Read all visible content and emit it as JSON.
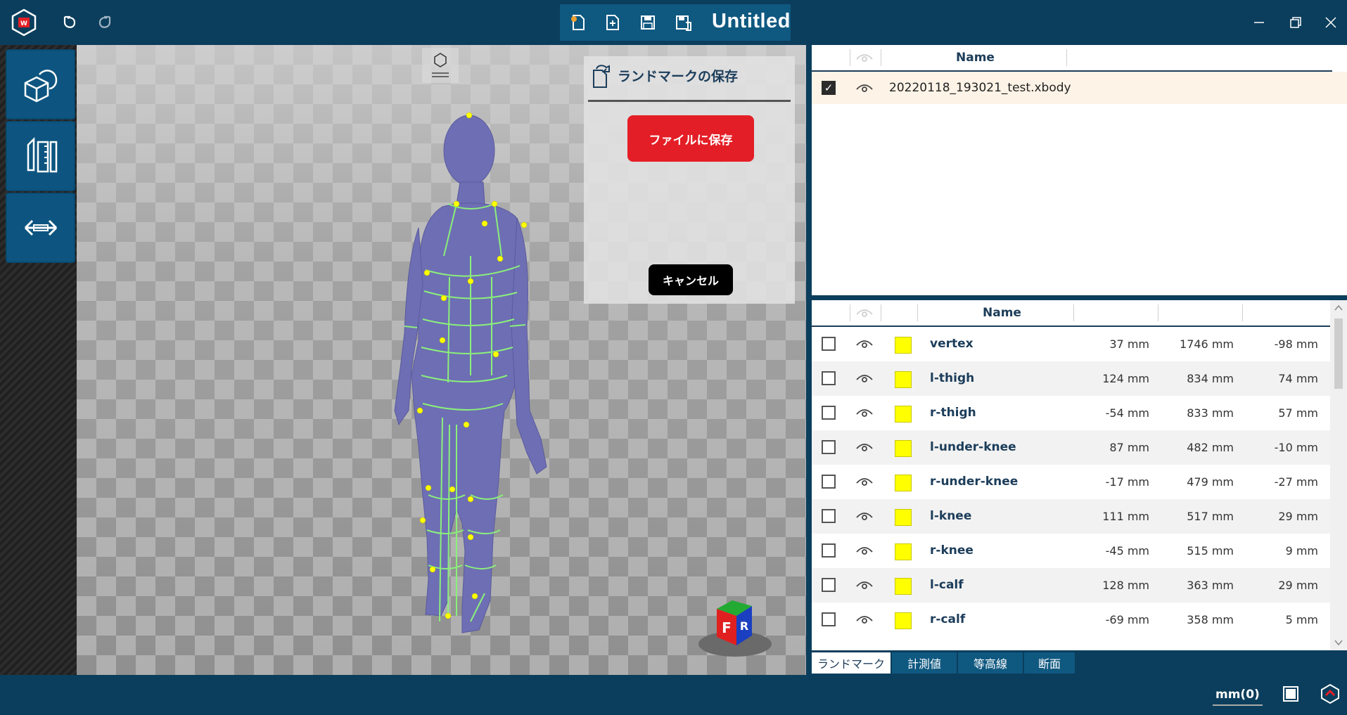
{
  "titlebar": {
    "document_title": "Untitled",
    "icons": [
      "app-logo-icon",
      "undo-icon",
      "redo-icon",
      "new-file-icon",
      "open-file-icon",
      "save-icon",
      "save-as-icon",
      "minimize-icon",
      "restore-icon",
      "close-icon"
    ]
  },
  "left_toolbar": {
    "buttons": [
      "model-view-icon",
      "measure-tools-icon",
      "dimension-arrows-icon"
    ]
  },
  "save_panel": {
    "title": "ランドマークの保存",
    "save_button": "ファイルに保存",
    "cancel_button": "キャンセル"
  },
  "file_list": {
    "header_name": "Name",
    "rows": [
      {
        "checked": true,
        "name": "20220118_193021_test.xbody"
      }
    ]
  },
  "landmark_list": {
    "header_name": "Name",
    "rows": [
      {
        "name": "vertex",
        "x": "37 mm",
        "y": "1746 mm",
        "z": "-98 mm"
      },
      {
        "name": "l-thigh",
        "x": "124 mm",
        "y": "834 mm",
        "z": "74 mm"
      },
      {
        "name": "r-thigh",
        "x": "-54 mm",
        "y": "833 mm",
        "z": "57 mm"
      },
      {
        "name": "l-under-knee",
        "x": "87 mm",
        "y": "482 mm",
        "z": "-10 mm"
      },
      {
        "name": "r-under-knee",
        "x": "-17 mm",
        "y": "479 mm",
        "z": "-27 mm"
      },
      {
        "name": "l-knee",
        "x": "111 mm",
        "y": "517 mm",
        "z": "29 mm"
      },
      {
        "name": "r-knee",
        "x": "-45 mm",
        "y": "515 mm",
        "z": "9 mm"
      },
      {
        "name": "l-calf",
        "x": "128 mm",
        "y": "363 mm",
        "z": "29 mm"
      },
      {
        "name": "r-calf",
        "x": "-69 mm",
        "y": "358 mm",
        "z": "5 mm"
      }
    ],
    "swatch_color": "#ffff00"
  },
  "tabs": [
    "ランドマーク",
    "計測値",
    "等高線",
    "断面"
  ],
  "active_tab": "ランドマーク",
  "status": {
    "unit": "mm(0)"
  },
  "view_cube": {
    "faces": [
      "F",
      "R"
    ]
  },
  "colors": {
    "accent": "#0b3e5c",
    "button_red": "#e41e26",
    "body": "#6e6eb4",
    "wire": "#8af07a",
    "landmark": "#ffff00"
  }
}
